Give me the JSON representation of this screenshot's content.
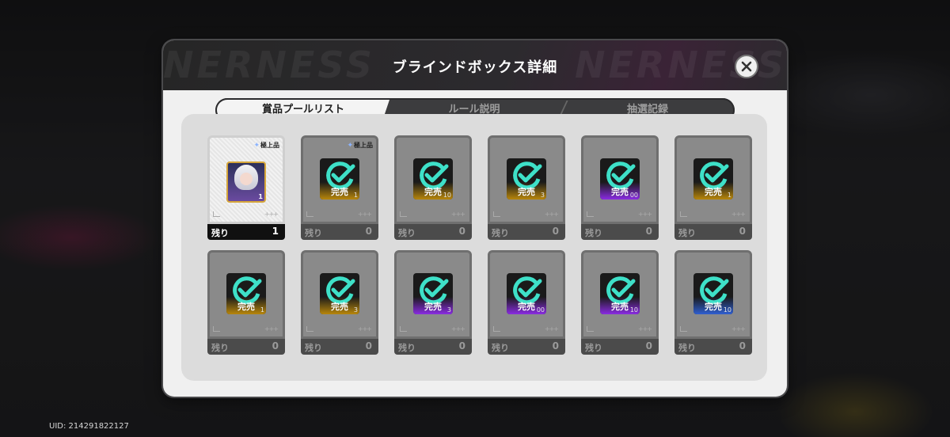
{
  "background": {
    "uid": "UID: 214291822127"
  },
  "modal": {
    "title": "ブラインドボックス詳細",
    "header_deco": "NERNESS",
    "tabs": [
      {
        "label": "賞品プールリスト",
        "active": true
      },
      {
        "label": "ルール説明",
        "active": false
      },
      {
        "label": "抽選記録",
        "active": false
      }
    ]
  },
  "labels": {
    "remain": "残り",
    "sold_out": "完売",
    "top_grade": "極上品"
  },
  "colors": {
    "accent_check": "#3ee0c8",
    "rarity_gold": "#b8860b",
    "rarity_purple": "#8a2be2",
    "rarity_blue": "#2f5fd0"
  },
  "prizes": [
    {
      "remaining": "1",
      "quantity": "1",
      "rarity": "gold",
      "sold_out": false,
      "top_grade": true,
      "icon": "character-portrait"
    },
    {
      "remaining": "0",
      "quantity": "1",
      "rarity": "gold",
      "sold_out": true,
      "top_grade": true,
      "icon": "checkmark-icon"
    },
    {
      "remaining": "0",
      "quantity": "10",
      "rarity": "gold",
      "sold_out": true,
      "top_grade": false,
      "icon": "checkmark-icon"
    },
    {
      "remaining": "0",
      "quantity": "3",
      "rarity": "gold",
      "sold_out": true,
      "top_grade": false,
      "icon": "checkmark-icon"
    },
    {
      "remaining": "0",
      "quantity": "00",
      "rarity": "purple",
      "sold_out": true,
      "top_grade": false,
      "icon": "checkmark-icon"
    },
    {
      "remaining": "0",
      "quantity": "1",
      "rarity": "gold",
      "sold_out": true,
      "top_grade": false,
      "icon": "checkmark-icon"
    },
    {
      "remaining": "0",
      "quantity": "1",
      "rarity": "gold",
      "sold_out": true,
      "top_grade": false,
      "icon": "checkmark-icon"
    },
    {
      "remaining": "0",
      "quantity": "3",
      "rarity": "gold",
      "sold_out": true,
      "top_grade": false,
      "icon": "checkmark-icon"
    },
    {
      "remaining": "0",
      "quantity": "3",
      "rarity": "purple",
      "sold_out": true,
      "top_grade": false,
      "icon": "checkmark-icon"
    },
    {
      "remaining": "0",
      "quantity": "00",
      "rarity": "purple",
      "sold_out": true,
      "top_grade": false,
      "icon": "checkmark-icon"
    },
    {
      "remaining": "0",
      "quantity": "10",
      "rarity": "purple",
      "sold_out": true,
      "top_grade": false,
      "icon": "checkmark-icon"
    },
    {
      "remaining": "0",
      "quantity": "10",
      "rarity": "blue",
      "sold_out": true,
      "top_grade": false,
      "icon": "checkmark-icon"
    }
  ]
}
